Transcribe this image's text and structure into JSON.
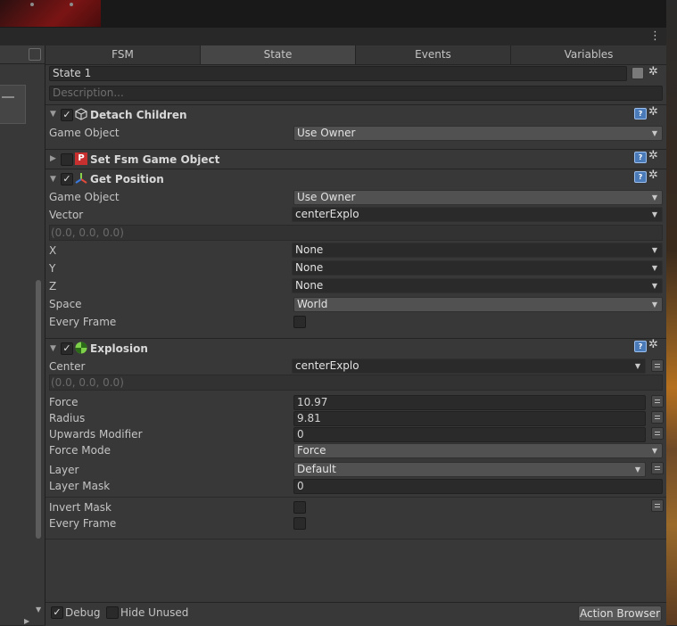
{
  "tabs": [
    "FSM",
    "State",
    "Events",
    "Variables"
  ],
  "state": {
    "name": "State 1",
    "description_placeholder": "Description..."
  },
  "actions": {
    "detach_children": {
      "title": "Detach Children",
      "game_object_label": "Game Object",
      "game_object_value": "Use Owner"
    },
    "set_fsm_game_object": {
      "title": "Set Fsm Game Object"
    },
    "get_position": {
      "title": "Get Position",
      "game_object_label": "Game Object",
      "game_object_value": "Use Owner",
      "vector_label": "Vector",
      "vector_value": "centerExplo",
      "vector_readout": "(0.0, 0.0, 0.0)",
      "x_label": "X",
      "x_value": "None",
      "y_label": "Y",
      "y_value": "None",
      "z_label": "Z",
      "z_value": "None",
      "space_label": "Space",
      "space_value": "World",
      "every_frame_label": "Every Frame"
    },
    "explosion": {
      "title": "Explosion",
      "center_label": "Center",
      "center_value": "centerExplo",
      "center_readout": "(0.0, 0.0, 0.0)",
      "force_label": "Force",
      "force_value": "10.97",
      "radius_label": "Radius",
      "radius_value": "9.81",
      "upwards_label": "Upwards Modifier",
      "upwards_value": "0",
      "force_mode_label": "Force Mode",
      "force_mode_value": "Force",
      "layer_label": "Layer",
      "layer_value": "Default",
      "layer_mask_label": "Layer Mask",
      "layer_mask_value": "0",
      "invert_mask_label": "Invert Mask",
      "every_frame_label": "Every Frame"
    }
  },
  "bottom": {
    "debug_label": "Debug",
    "hide_unused_label": "Hide Unused",
    "action_browser_label": "Action Browser"
  },
  "glyphs": {
    "check": "✓",
    "gear": "✲",
    "help": "?",
    "fold_open": "▼",
    "fold_closed": "▶",
    "dropdown": "▼",
    "kebab": "⋮"
  },
  "colors": {
    "panel": "#383838",
    "active_tab": "#464646",
    "field": "#2a2a2a",
    "dropdown": "#515151",
    "help_icon": "#4a7ab8"
  }
}
